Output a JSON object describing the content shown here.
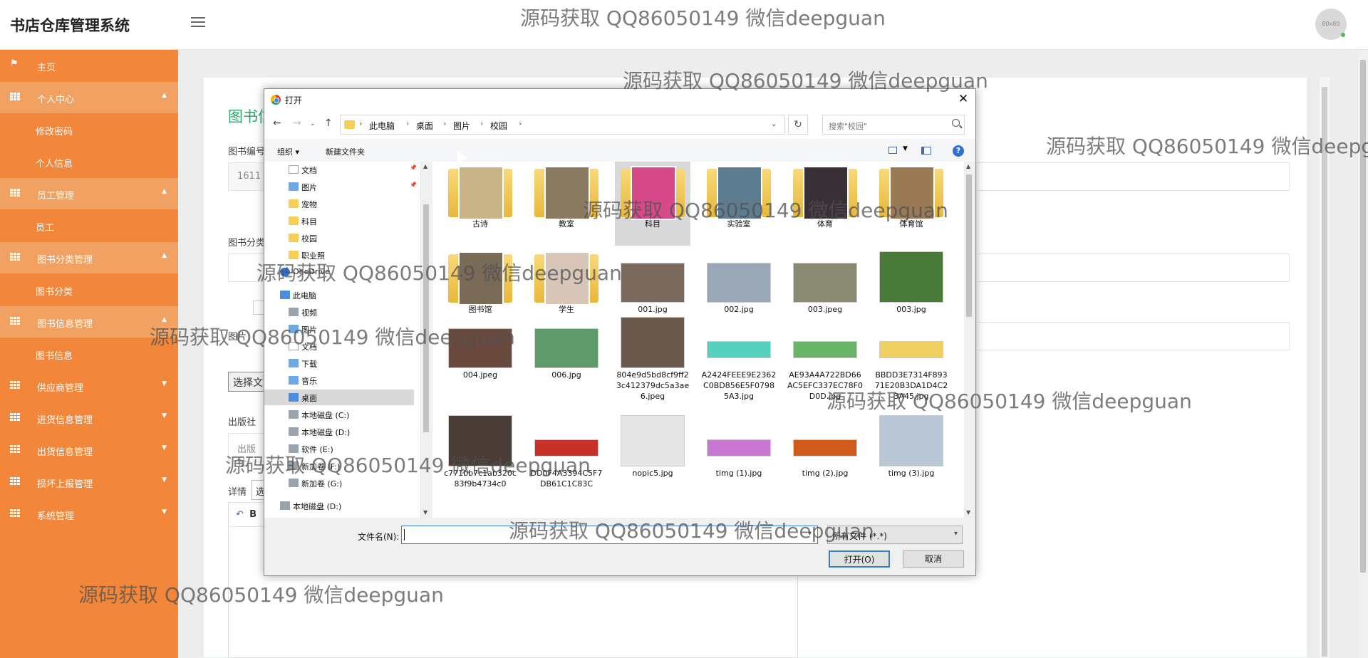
{
  "app": {
    "title": "书店仓库管理系统",
    "avatar_text": "80x80"
  },
  "sidebar": {
    "items": [
      {
        "label": "主页",
        "icon": "flag-icon"
      },
      {
        "label": "个人中心",
        "icon": "grid-icon",
        "caret": "▲"
      },
      {
        "label": "修改密码"
      },
      {
        "label": "个人信息"
      },
      {
        "label": "员工管理",
        "icon": "grid-icon",
        "caret": "▲"
      },
      {
        "label": "员工"
      },
      {
        "label": "图书分类管理",
        "icon": "grid-icon",
        "caret": "▲"
      },
      {
        "label": "图书分类"
      },
      {
        "label": "图书信息管理",
        "icon": "grid-icon",
        "caret": "▲"
      },
      {
        "label": "图书信息"
      },
      {
        "label": "供应商管理",
        "icon": "grid-icon",
        "caret": "▼"
      },
      {
        "label": "进货信息管理",
        "icon": "grid-icon",
        "caret": "▼"
      },
      {
        "label": "出货信息管理",
        "icon": "grid-icon",
        "caret": "▼"
      },
      {
        "label": "损坏上报管理",
        "icon": "grid-icon",
        "caret": "▼"
      },
      {
        "label": "系统管理",
        "icon": "grid-icon",
        "caret": "▼"
      }
    ]
  },
  "form": {
    "title": "图书信",
    "book_no_label": "图书编号",
    "book_no_value": "1611",
    "category_label": "图书分类",
    "image_label": "图片",
    "choose_file": "选择文",
    "publisher_label": "出版社",
    "publisher_placeholder": "出版社",
    "detail_label": "详情",
    "detail_select": "选",
    "editor_toolbar": "B"
  },
  "dialog": {
    "title": "打开",
    "address": [
      "此电脑",
      "桌面",
      "图片",
      "校园"
    ],
    "search_placeholder": "搜索\"校园\"",
    "toolbar": {
      "organize": "组织 ▾",
      "new_folder": "新建文件夹"
    },
    "tree": [
      {
        "label": "文档",
        "icon": "document-icon",
        "pinned": true
      },
      {
        "label": "图片",
        "icon": "pictures-icon",
        "pinned": true
      },
      {
        "label": "宠物",
        "icon": "folder-icon"
      },
      {
        "label": "科目",
        "icon": "folder-icon"
      },
      {
        "label": "校园",
        "icon": "folder-icon"
      },
      {
        "label": "职业照",
        "icon": "folder-icon"
      },
      {
        "label": "OneDrive",
        "icon": "onedrive-icon"
      },
      {
        "label": "此电脑",
        "icon": "computer-icon"
      },
      {
        "label": "视频",
        "icon": "video-icon"
      },
      {
        "label": "图片",
        "icon": "pictures-icon"
      },
      {
        "label": "文档",
        "icon": "document-icon"
      },
      {
        "label": "下载",
        "icon": "download-icon"
      },
      {
        "label": "音乐",
        "icon": "music-icon"
      },
      {
        "label": "桌面",
        "icon": "desktop-icon",
        "selected": true
      },
      {
        "label": "本地磁盘 (C:)",
        "icon": "drive-icon"
      },
      {
        "label": "本地磁盘 (D:)",
        "icon": "drive-icon"
      },
      {
        "label": "软件 (E:)",
        "icon": "drive-icon"
      },
      {
        "label": "新加卷 (F:)",
        "icon": "drive-icon"
      },
      {
        "label": "新加卷 (G:)",
        "icon": "drive-icon"
      },
      {
        "label": "本地磁盘 (D:)",
        "icon": "drive-icon"
      }
    ],
    "files": [
      {
        "name": "古诗",
        "kind": "folder",
        "color": "#c9b48a"
      },
      {
        "name": "教室",
        "kind": "folder",
        "color": "#8a7a62"
      },
      {
        "name": "科目",
        "kind": "folder",
        "color": "#d64a8a",
        "selected": true
      },
      {
        "name": "实验室",
        "kind": "folder",
        "color": "#5d7c8f"
      },
      {
        "name": "体育",
        "kind": "folder",
        "color": "#3a3038"
      },
      {
        "name": "体育馆",
        "kind": "folder",
        "color": "#9a7a54"
      },
      {
        "name": "图书馆",
        "kind": "folder",
        "color": "#7a6a58"
      },
      {
        "name": "学生",
        "kind": "folder",
        "color": "#d8c6b8"
      },
      {
        "name": "001.jpg",
        "kind": "image",
        "color": "#7a6a5e"
      },
      {
        "name": "002.jpg",
        "kind": "image",
        "color": "#9aa7b6"
      },
      {
        "name": "003.jpeg",
        "kind": "image",
        "color": "#8a8a72"
      },
      {
        "name": "003.jpg",
        "kind": "image",
        "color": "#4a7a3a",
        "tall": true
      },
      {
        "name": "004.jpeg",
        "kind": "image",
        "color": "#6a4a3e"
      },
      {
        "name": "006.jpg",
        "kind": "image",
        "color": "#5f9a6a"
      },
      {
        "name": "804e9d5bd8cf9ff23c412379dc5a3ae6.jpeg",
        "kind": "image",
        "color": "#6a5a4e",
        "tall": true
      },
      {
        "name": "A2424FEEE9E2362C0BD856E5F07985A3.jpg",
        "kind": "image",
        "color": "#58d0c0",
        "thin": true
      },
      {
        "name": "AE93A4A722BD66AC5EFC337EC78F0D0D.jpg",
        "kind": "image",
        "color": "#6ab46a",
        "thin": true
      },
      {
        "name": "BBDD3E7314F89371E20B3DA1D4C23A45.jpg",
        "kind": "image",
        "color": "#f0d060",
        "thin": true
      },
      {
        "name": "c771bb7c1ab320c83f9b4734c0",
        "kind": "image",
        "color": "#4a3c36",
        "tall": true
      },
      {
        "name": "DD0F4A3394C5F7DB61C1C83C",
        "kind": "image",
        "color": "#c8302a",
        "thin": true
      },
      {
        "name": "nopic5.jpg",
        "kind": "image",
        "color": "#e6e6e6",
        "tall": true
      },
      {
        "name": "timg (1).jpg",
        "kind": "image",
        "color": "#c878d0",
        "thin": true
      },
      {
        "name": "timg (2).jpg",
        "kind": "image",
        "color": "#d05a1a",
        "thin": true
      },
      {
        "name": "timg (3).jpg",
        "kind": "image",
        "color": "#b8c6d6",
        "tall": true
      }
    ],
    "filename_label": "文件名(N):",
    "filename_value": "",
    "filetype": "所有文件 (*.*)",
    "open_button": "打开(O)",
    "cancel_button": "取消"
  },
  "watermark": "源码获取 QQ86050149 微信deepguan"
}
